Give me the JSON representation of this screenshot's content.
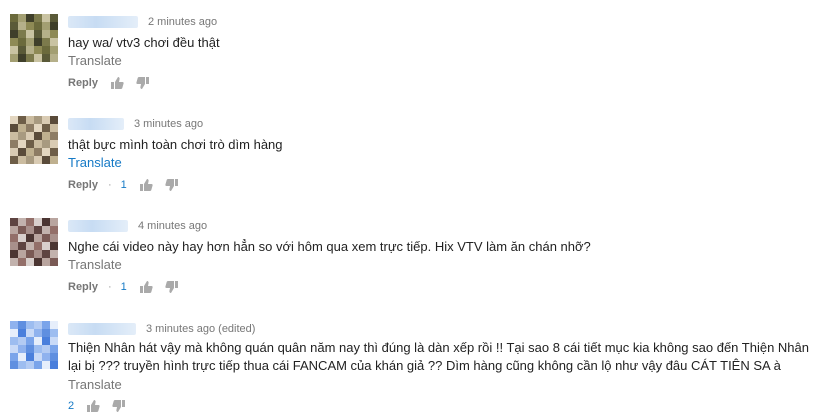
{
  "comments": [
    {
      "time": "2 minutes ago",
      "lines": [
        "hay wa/ vtv3 chơi đều thật"
      ],
      "translate": "Translate",
      "reply": "Reply",
      "likes": ""
    },
    {
      "time": "3 minutes ago",
      "lines": [
        "thật bực mình toàn chơi trò dìm hàng"
      ],
      "translate": "Translate",
      "reply": "Reply",
      "likes": "1"
    },
    {
      "time": "4 minutes ago",
      "lines": [
        "Nghe cái video này hay hơn hẳn so với hôm qua xem trực tiếp. Hix VTV làm ăn chán nhỡ?"
      ],
      "translate": "Translate",
      "reply": "Reply",
      "likes": "1"
    },
    {
      "time": "3 minutes ago (edited)",
      "lines": [
        "Thiện Nhân hát vậy mà không quán quân năm nay thì đúng là dàn xếp rồi !! Tại sao 8 cái tiết mục kia không sao đến Thiện Nhân",
        "lại bị ??? truyền hình trực tiếp thua cái FANCAM của khán giả ?? Dìm hàng cũng không cần lộ như vậy đâu CÁT TIÊN SA à"
      ],
      "translate": "Translate",
      "reply": "",
      "likes": "2"
    }
  ],
  "icons": {
    "like": "thumbs-up-icon",
    "dislike": "thumbs-down-icon"
  },
  "colors": {
    "link": "#167ac6",
    "muted": "#767676",
    "text": "#222222"
  }
}
